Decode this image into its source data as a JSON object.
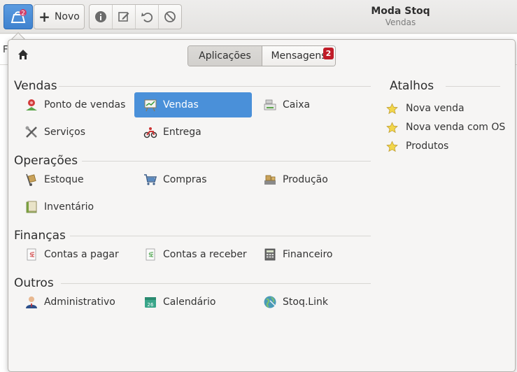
{
  "header": {
    "new_label": "Novo",
    "title": "Moda Stoq",
    "subtitle": "Vendas",
    "app_badge": "2"
  },
  "background": {
    "left_letter": "F"
  },
  "popover": {
    "tabs": {
      "applications": "Aplicações",
      "messages": "Mensagens",
      "messages_badge": "2"
    },
    "sections": [
      {
        "title": "Vendas",
        "items": [
          {
            "label": "Ponto de vendas",
            "icon": "pos-icon"
          },
          {
            "label": "Vendas",
            "icon": "sales-chart-icon",
            "selected": true
          },
          {
            "label": "Caixa",
            "icon": "cash-register-icon"
          },
          {
            "label": "Serviços",
            "icon": "tools-icon"
          },
          {
            "label": "Entrega",
            "icon": "motorcycle-icon"
          }
        ]
      },
      {
        "title": "Operações",
        "items": [
          {
            "label": "Estoque",
            "icon": "hand-truck-icon"
          },
          {
            "label": "Compras",
            "icon": "cart-icon"
          },
          {
            "label": "Produção",
            "icon": "production-icon"
          },
          {
            "label": "Inventário",
            "icon": "inventory-icon"
          }
        ]
      },
      {
        "title": "Finanças",
        "items": [
          {
            "label": "Contas a pagar",
            "icon": "payable-icon"
          },
          {
            "label": "Contas a receber",
            "icon": "receivable-icon"
          },
          {
            "label": "Financeiro",
            "icon": "calculator-icon"
          }
        ]
      },
      {
        "title": "Outros",
        "items": [
          {
            "label": "Administrativo",
            "icon": "admin-user-icon"
          },
          {
            "label": "Calendário",
            "icon": "calendar-icon"
          },
          {
            "label": "Stoq.Link",
            "icon": "globe-icon"
          }
        ]
      }
    ],
    "calendar_day": "26",
    "shortcuts": {
      "title": "Atalhos",
      "items": [
        "Nova venda",
        "Nova venda com OS",
        "Produtos"
      ]
    }
  }
}
